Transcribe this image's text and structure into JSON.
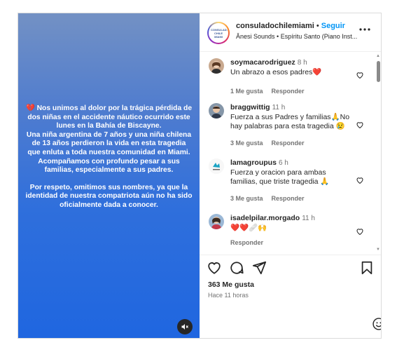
{
  "post": {
    "paragraph1": "💔 Nos unimos al dolor por la trágica pérdida de dos niñas en el accidente náutico ocurrido este lunes en la Bahía de Biscayne.\nUna niña argentina de 7 años y una niña chilena de 13 años perdieron la vida en esta tragedia que enluta a toda nuestra comunidad en Miami.\nAcompañamos con profundo pesar a sus familias, especialmente a sus padres.",
    "paragraph2": "Por respeto, omitimos sus nombres, ya que la identidad de nuestra compatriota aún no ha sido oficialmente dada a conocer."
  },
  "header": {
    "username": "consuladochilemiami",
    "separator": "•",
    "follow_label": "Seguir",
    "audio": "Ânesi Sounds • Espíritu Santo (Piano Inst...",
    "avatar_text": "CONSULADO CHILE MIAMI"
  },
  "comments": [
    {
      "user": "soymacarodriguez",
      "time": "8 h",
      "text": "Un abrazo a esos padres❤️",
      "likes": "1 Me gusta",
      "reply": "Responder",
      "avatar_icon": "woman-avatar"
    },
    {
      "user": "braggwittig",
      "time": "11 h",
      "text": "Fuerza a sus Padres y familias🙏No hay palabras para esta tragedia 😢",
      "likes": "3 Me gusta",
      "reply": "Responder",
      "avatar_icon": "man-avatar"
    },
    {
      "user": "lamagroupus",
      "time": "6 h",
      "text": "Fuerza y oracion para ambas familias, que triste tragedia 🙏",
      "likes": "3 Me gusta",
      "reply": "Responder",
      "avatar_icon": "logo-avatar"
    },
    {
      "user": "isadelpilar.morgado",
      "time": "11 h",
      "text": "❤️❤️🩹🙌",
      "likes": "",
      "reply": "Responder",
      "avatar_icon": "woman-avatar"
    }
  ],
  "footer": {
    "likes": "363 Me gusta",
    "time_ago": "Hace 11 horas"
  },
  "colors": {
    "accent": "#0095f6",
    "media_top": "#7391c4",
    "media_bottom": "#1f66e0"
  }
}
